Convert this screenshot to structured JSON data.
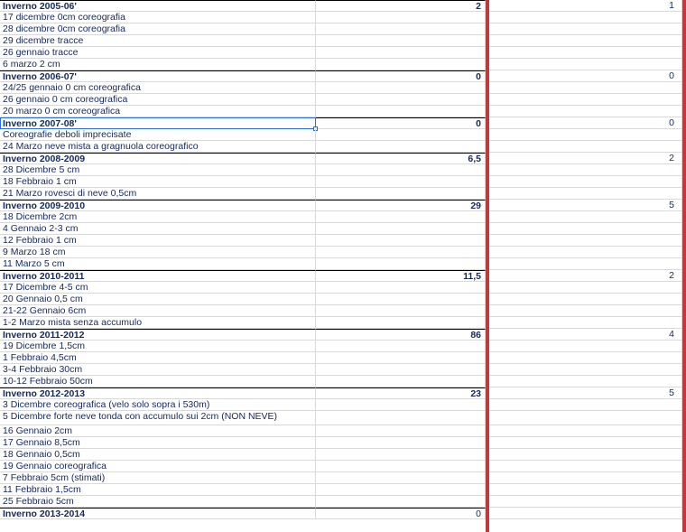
{
  "rows": [
    {
      "a": "Inverno 2005-06'",
      "b": "2",
      "c": "1",
      "header": true
    },
    {
      "a": "17 dicembre 0cm coreografia",
      "b": "",
      "c": ""
    },
    {
      "a": "28 dicembre 0cm coreografia",
      "b": "",
      "c": ""
    },
    {
      "a": "29 dicembre tracce",
      "b": "",
      "c": ""
    },
    {
      "a": "26 gennaio tracce",
      "b": "",
      "c": ""
    },
    {
      "a": "6 marzo 2 cm",
      "b": "",
      "c": ""
    },
    {
      "a": "Inverno 2006-07'",
      "b": "0",
      "c": "0",
      "header": true
    },
    {
      "a": "24/25 gennaio 0 cm coreografica",
      "b": "",
      "c": ""
    },
    {
      "a": "26 gennaio 0 cm  coreografica",
      "b": "",
      "c": ""
    },
    {
      "a": "20 marzo 0 cm coreografica",
      "b": "",
      "c": ""
    },
    {
      "a": "Inverno 2007-08'",
      "b": "0",
      "c": "0",
      "header": true,
      "selected": true
    },
    {
      "a": "Coreografie deboli imprecisate",
      "b": "",
      "c": ""
    },
    {
      "a": "24 Marzo neve mista a gragnuola coreografico",
      "b": "",
      "c": ""
    },
    {
      "a": "Inverno 2008-2009",
      "b": "6,5",
      "c": "2",
      "header": true
    },
    {
      "a": "28 Dicembre  5 cm",
      "b": "",
      "c": ""
    },
    {
      "a": "18 Febbraio 1 cm",
      "b": "",
      "c": ""
    },
    {
      "a": "21 Marzo rovesci di neve 0,5cm",
      "b": "",
      "c": ""
    },
    {
      "a": "Inverno 2009-2010",
      "b": "29",
      "c": "5",
      "header": true
    },
    {
      "a": "18 Dicembre 2cm",
      "b": "",
      "c": ""
    },
    {
      "a": "4 Gennaio 2-3 cm",
      "b": "",
      "c": ""
    },
    {
      "a": "12 Febbraio 1 cm",
      "b": "",
      "c": ""
    },
    {
      "a": "9 Marzo 18 cm",
      "b": "",
      "c": ""
    },
    {
      "a": "11 Marzo 5 cm",
      "b": "",
      "c": ""
    },
    {
      "a": "Inverno 2010-2011",
      "b": "11,5",
      "c": "2",
      "header": true
    },
    {
      "a": "17 Dicembre 4-5 cm",
      "b": "",
      "c": ""
    },
    {
      "a": "20 Gennaio 0,5 cm",
      "b": "",
      "c": ""
    },
    {
      "a": "21-22 Gennaio 6cm",
      "b": "",
      "c": ""
    },
    {
      "a": "1-2 Marzo mista senza accumulo",
      "b": "",
      "c": ""
    },
    {
      "a": "Inverno 2011-2012",
      "b": "86",
      "c": "4",
      "header": true
    },
    {
      "a": "19 Dicembre 1,5cm",
      "b": "",
      "c": ""
    },
    {
      "a": "1 Febbraio 4,5cm",
      "b": "",
      "c": ""
    },
    {
      "a": "3-4 Febbraio 30cm",
      "b": "",
      "c": ""
    },
    {
      "a": "10-12 Febbraio 50cm",
      "b": "",
      "c": ""
    },
    {
      "a": "Inverno 2012-2013",
      "b": "23",
      "c": "5",
      "header": true
    },
    {
      "a": "3 Dicembre coreografica (velo solo sopra i 530m)",
      "b": "",
      "c": ""
    },
    {
      "a": "5 Dicembre forte neve tonda con accumulo sui 2cm (NON NEVE)",
      "b": "",
      "c": "",
      "tall": true
    },
    {
      "a": "16 Gennaio 2cm",
      "b": "",
      "c": ""
    },
    {
      "a": "17 Gennaio 8,5cm",
      "b": "",
      "c": ""
    },
    {
      "a": "18 Gennaio 0,5cm",
      "b": "",
      "c": ""
    },
    {
      "a": "19 Gennaio coreografica",
      "b": "",
      "c": ""
    },
    {
      "a": "7 Febbraio 5cm (stimati)",
      "b": "",
      "c": ""
    },
    {
      "a": "11 Febbraio 1,5cm",
      "b": "",
      "c": ""
    },
    {
      "a": "25 Febbraio 5cm",
      "b": "",
      "c": ""
    },
    {
      "a": "Inverno 2013-2014",
      "b": "0",
      "c": "",
      "header": true,
      "plain_b": true
    }
  ],
  "colors": {
    "text": "#14285a",
    "grid": "#d9d9d9",
    "red_divider": "#c0393b",
    "selection": "#2a6fd6"
  }
}
